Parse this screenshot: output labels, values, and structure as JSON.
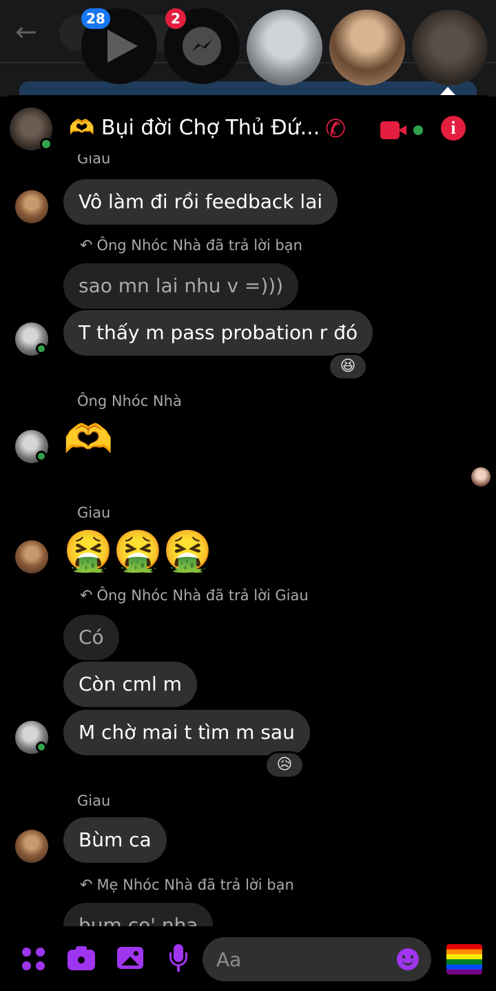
{
  "background_app": {
    "badges": {
      "videos": "28",
      "messenger": "2"
    }
  },
  "chat_header": {
    "title": "🫶 Bụi đời Chợ Thủ Đứ...",
    "icons": [
      "phone-icon",
      "video-call-icon",
      "info-icon"
    ]
  },
  "messages": {
    "cut_sender": "Giau",
    "m1": "Vô làm đi rồi feedback lai",
    "reply1": "Ông Nhóc Nhà đã trả lời bạn",
    "quote1": "sao mn lai nhu v =)))",
    "m2": "T thấy m pass probation r đó",
    "reaction1": "😆",
    "sender_ong": "Ông Nhóc Nhà",
    "heart_hands": "🫶",
    "sender_giau_1": "Giau",
    "vomit": "🤮🤮🤮",
    "reply2": "Ông Nhóc Nhà đã trả lời Giau",
    "quote2": "Có",
    "m3": "Còn cml m",
    "m4": "M chờ mai t tìm m sau",
    "reaction2": "😥",
    "sender_giau_2": "Giau",
    "m5": "Bùm ca",
    "reply3": "Mẹ Nhóc Nhà đã trả lời bạn",
    "quote3": "bum co' nha"
  },
  "composer": {
    "placeholder": "Aa",
    "icons": [
      "apps-icon",
      "camera-icon",
      "gallery-icon",
      "microphone-icon",
      "emoji-icon",
      "pride-flag-icon"
    ]
  },
  "colors": {
    "accent": "#a035f0",
    "header_icons": "#e41e3f",
    "online": "#31a24c",
    "bubble": "#303030"
  }
}
